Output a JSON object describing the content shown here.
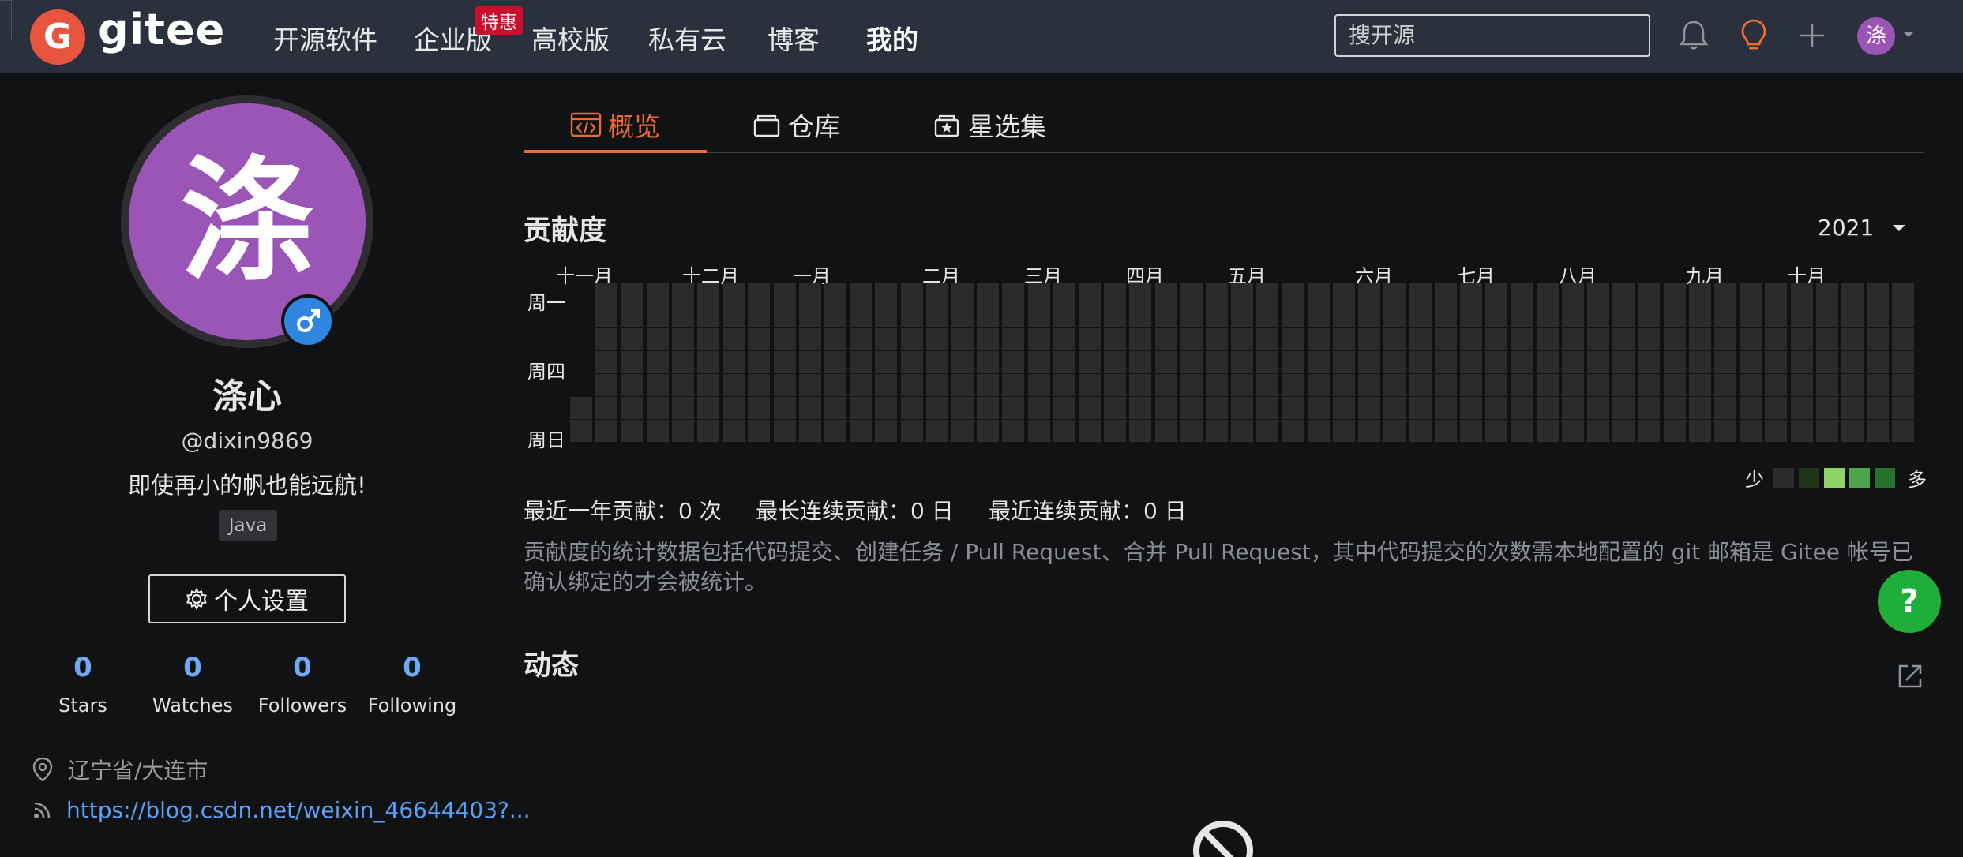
{
  "header": {
    "logo_letter": "G",
    "brand": "gitee",
    "nav": [
      "开源软件",
      "企业版",
      "高校版",
      "私有云",
      "博客",
      "我的"
    ],
    "promo_badge": "特惠",
    "search_placeholder": "搜开源",
    "icons": [
      "bell-icon",
      "lightbulb-icon",
      "plus-icon"
    ],
    "avatar_initial": "涤",
    "accent": "#e8553e"
  },
  "profile": {
    "avatar_initial": "涤",
    "avatar_color": "#9b55b7",
    "gender_icon": "male-icon",
    "name": "涤心",
    "handle": "@dixin9869",
    "bio": "即使再小的帆也能远航!",
    "tag": "Java",
    "settings_label": "个人设置",
    "stats": [
      {
        "value": "0",
        "label": "Stars"
      },
      {
        "value": "0",
        "label": "Watches"
      },
      {
        "value": "0",
        "label": "Followers"
      },
      {
        "value": "0",
        "label": "Following"
      }
    ],
    "location": "辽宁省/大连市",
    "link": "https://blog.csdn.net/weixin_46644403?..."
  },
  "tabs": [
    {
      "label": "概览",
      "icon": "code-window-icon",
      "active": true
    },
    {
      "label": "仓库",
      "icon": "repository-icon",
      "active": false
    },
    {
      "label": "星选集",
      "icon": "star-collection-icon",
      "active": false
    }
  ],
  "contribution": {
    "title": "贡献度",
    "year": "2021",
    "months": [
      "十一月",
      "十二月",
      "一月",
      "二月",
      "三月",
      "四月",
      "五月",
      "六月",
      "七月",
      "八月",
      "九月",
      "十月"
    ],
    "weekdays": [
      "周一",
      "周四",
      "周日"
    ],
    "legend_less": "少",
    "legend_more": "多",
    "legend_colors": [
      "#2a2b2d",
      "#213616",
      "#8fd36b",
      "#4ea64b",
      "#26722c"
    ],
    "summary": {
      "year_total": "最近一年贡献：0 次",
      "longest_streak": "最长连续贡献：0 日",
      "current_streak": "最近连续贡献：0 日"
    },
    "note": "贡献度的统计数据包括代码提交、创建任务 / Pull Request、合并 Pull Request，其中代码提交的次数需本地配置的 git 邮箱是 Gitee 帐号已确认绑定的才会被统计。"
  },
  "activity": {
    "title": "动态"
  },
  "floating": {
    "help_label": "?"
  }
}
